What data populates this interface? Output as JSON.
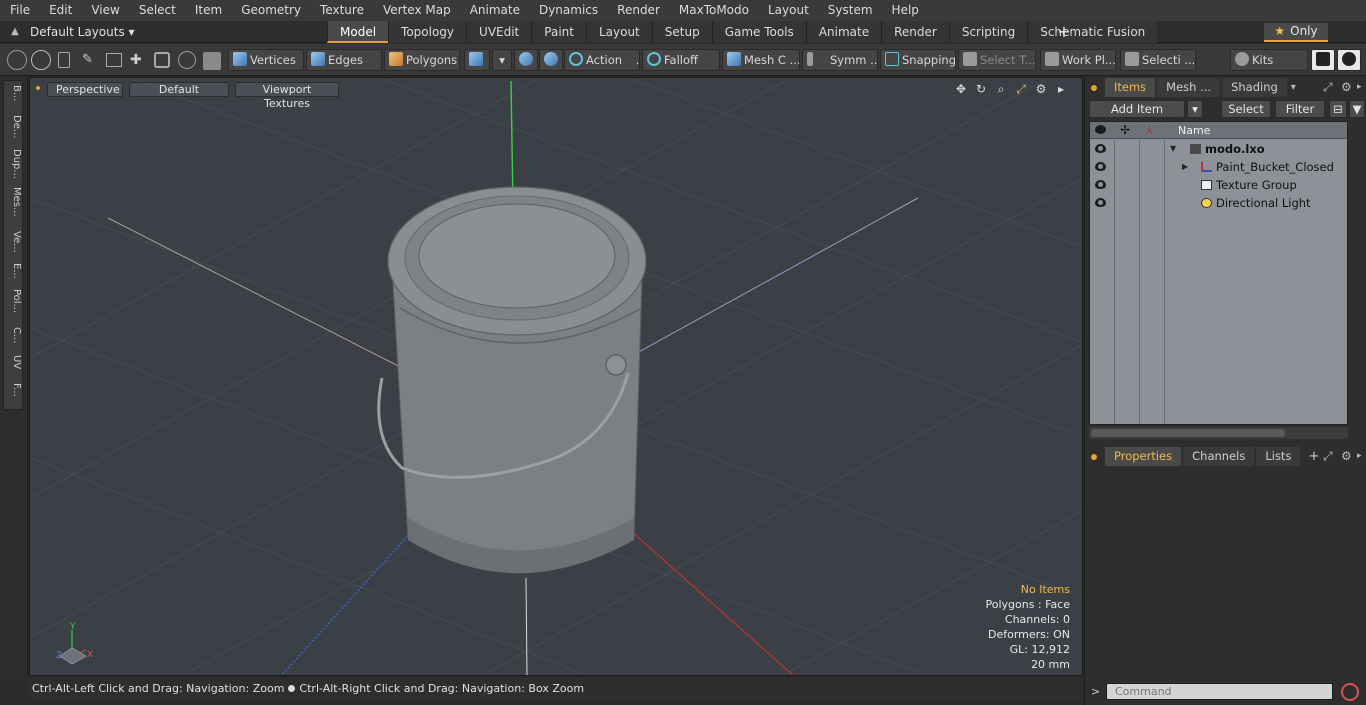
{
  "menubar": [
    "File",
    "Edit",
    "View",
    "Select",
    "Item",
    "Geometry",
    "Texture",
    "Vertex Map",
    "Animate",
    "Dynamics",
    "Render",
    "MaxToModo",
    "Layout",
    "System",
    "Help"
  ],
  "layout": {
    "selector": "Default Layouts ▾",
    "tabs": [
      "Model",
      "Topology",
      "UVEdit",
      "Paint",
      "Layout",
      "Setup",
      "Game Tools",
      "Animate",
      "Render",
      "Scripting",
      "Schematic Fusion"
    ],
    "active_tab": "Model",
    "add": "+",
    "only": "Only"
  },
  "toolbar": {
    "vertices": "Vertices",
    "edges": "Edges",
    "polygons": "Polygons",
    "action": "Action",
    "action_more": "...",
    "falloff": "Falloff",
    "mesh": "Mesh C ...",
    "symm": "Symm ...",
    "snapping": "Snapping",
    "select_t": "Select T...",
    "work_plane": "Work Pl...",
    "selection": "Selecti ...",
    "kits": "Kits"
  },
  "left_strip": [
    "B...",
    "De...",
    "Dup...",
    "Mes...",
    "Ve...",
    "E...",
    "Pol...",
    "C...",
    "UV",
    "F..."
  ],
  "viewport": {
    "projection": "Perspective",
    "shading": "Default",
    "textures": "Viewport Textures",
    "info": {
      "items": "No Items",
      "polygons": "Polygons : Face",
      "channels": "Channels: 0",
      "deformers": "Deformers: ON",
      "gl": "GL: 12,912",
      "scale": "20 mm"
    },
    "axis_labels": {
      "x": "X",
      "y": "Y",
      "z": "Z"
    }
  },
  "status": {
    "left": "Ctrl-Alt-Left Click and Drag: Navigation: Zoom",
    "right": "Ctrl-Alt-Right Click and Drag: Navigation: Box Zoom"
  },
  "items_panel": {
    "tabs": [
      "Items",
      "Mesh ...",
      "Shading"
    ],
    "add_item": "Add Item",
    "select": "Select",
    "filter": "Filter",
    "header_name": "Name",
    "rows": [
      {
        "label": "modo.lxo",
        "bold": true
      },
      {
        "label": "Paint_Bucket_Closed"
      },
      {
        "label": "Texture Group"
      },
      {
        "label": "Directional Light"
      }
    ]
  },
  "props_panel": {
    "tabs": [
      "Properties",
      "Channels",
      "Lists"
    ],
    "add": "+"
  },
  "command": {
    "placeholder": "Command",
    "prompt": ">"
  }
}
